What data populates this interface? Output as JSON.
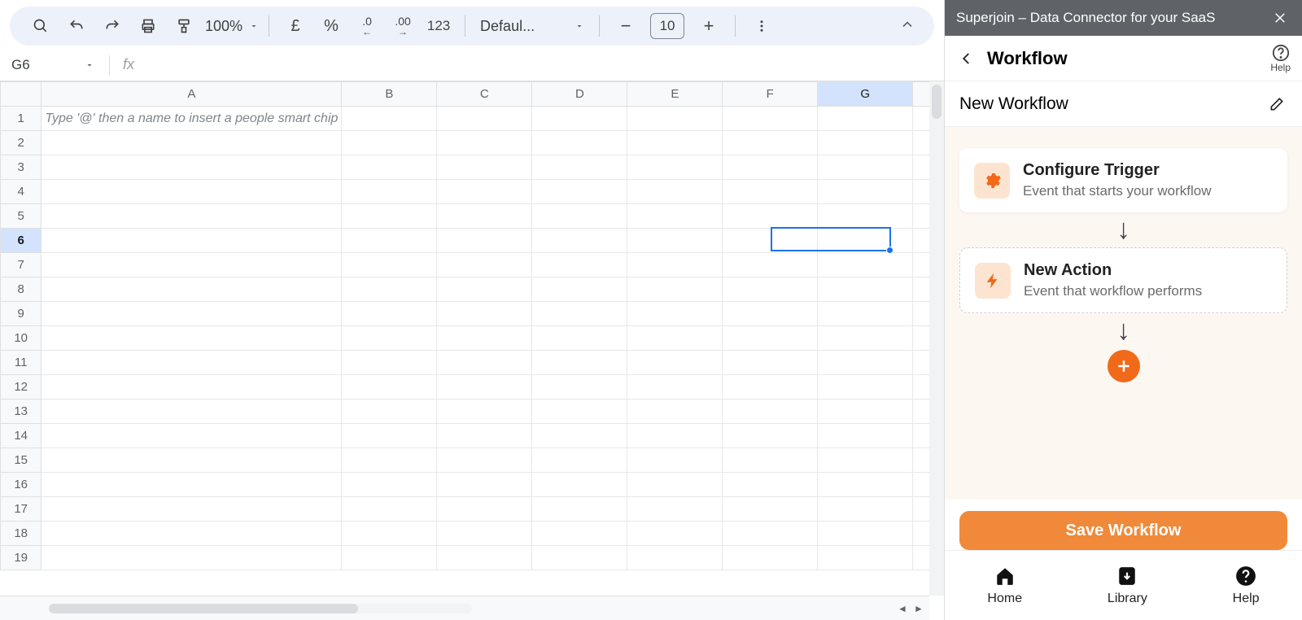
{
  "toolbar": {
    "zoom": "100%",
    "currency_symbol": "£",
    "percent_symbol": "%",
    "dec_minus_label": ".0",
    "dec_plus_label": ".00",
    "format_123": "123",
    "font_name": "Defaul...",
    "font_size": "10"
  },
  "name_box": "G6",
  "fx": "fx",
  "columns": [
    "A",
    "B",
    "C",
    "D",
    "E",
    "F",
    "G"
  ],
  "rows": [
    1,
    2,
    3,
    4,
    5,
    6,
    7,
    8,
    9,
    10,
    11,
    12,
    13,
    14,
    15,
    16,
    17,
    18,
    19
  ],
  "selected_col": "G",
  "selected_row": 6,
  "cell_placeholder": "Type '@' then a name to insert a people smart chip",
  "sidebar": {
    "header": "Superjoin – Data Connector for your SaaS",
    "nav_title": "Workflow",
    "help_label": "Help",
    "workflow_name": "New Workflow",
    "trigger": {
      "title": "Configure Trigger",
      "sub": "Event that starts your workflow"
    },
    "action": {
      "title": "New Action",
      "sub": "Event that workflow performs"
    },
    "save_label": "Save Workflow",
    "footer": {
      "home": "Home",
      "library": "Library",
      "help": "Help"
    }
  }
}
